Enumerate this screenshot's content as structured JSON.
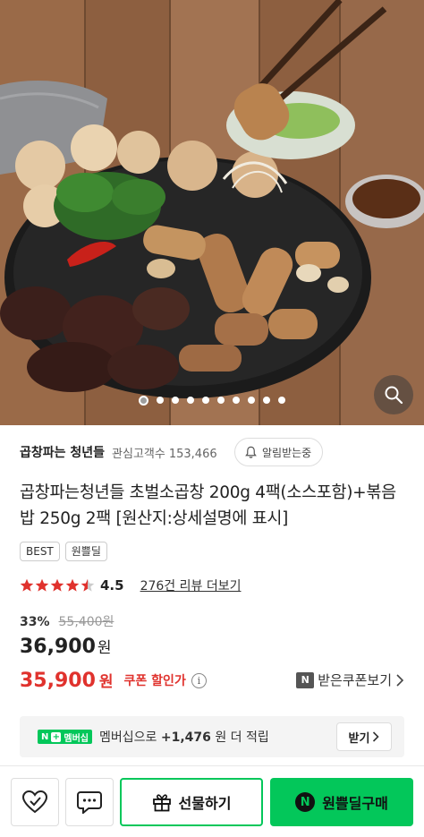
{
  "store": {
    "name": "곱창파는 청년들",
    "interest_label": "관심고객수",
    "interest_count": "153,466",
    "notify_label": "알림받는중"
  },
  "product": {
    "title": "곱창파는청년들 초벌소곱창 200g 4팩(소스포함)+볶음밥 250g 2팩 [원산지:상세설명에 표시]",
    "badges": [
      "BEST",
      "원쁠딜"
    ]
  },
  "rating": {
    "score": "4.5",
    "review_link": "276건 리뷰 더보기"
  },
  "price": {
    "discount_pct": "33%",
    "original": "55,400원",
    "sale": "36,900",
    "sale_unit": "원",
    "coupon_price": "35,900",
    "coupon_unit": "원",
    "coupon_label": "쿠폰 할인가",
    "coupon_link": "받은쿠폰보기"
  },
  "membership": {
    "logo": "멤버십",
    "text_prefix": "멤버십으로",
    "points": "+1,476",
    "text_suffix": "원 더 적립",
    "receive_label": "받기"
  },
  "bottom_bar": {
    "gift_label": "선물하기",
    "buy_label": "원쁠딜구매"
  },
  "carousel": {
    "total": 10,
    "active_index": 0
  },
  "colors": {
    "naver_green": "#03c75a",
    "coupon_red": "#e0322d",
    "star_red": "#e0322d"
  },
  "icons": [
    "search-icon",
    "bell-icon",
    "heart-icon",
    "chat-icon",
    "gift-icon",
    "naver-n-icon",
    "chevron-right-icon",
    "info-icon",
    "star-icon"
  ]
}
